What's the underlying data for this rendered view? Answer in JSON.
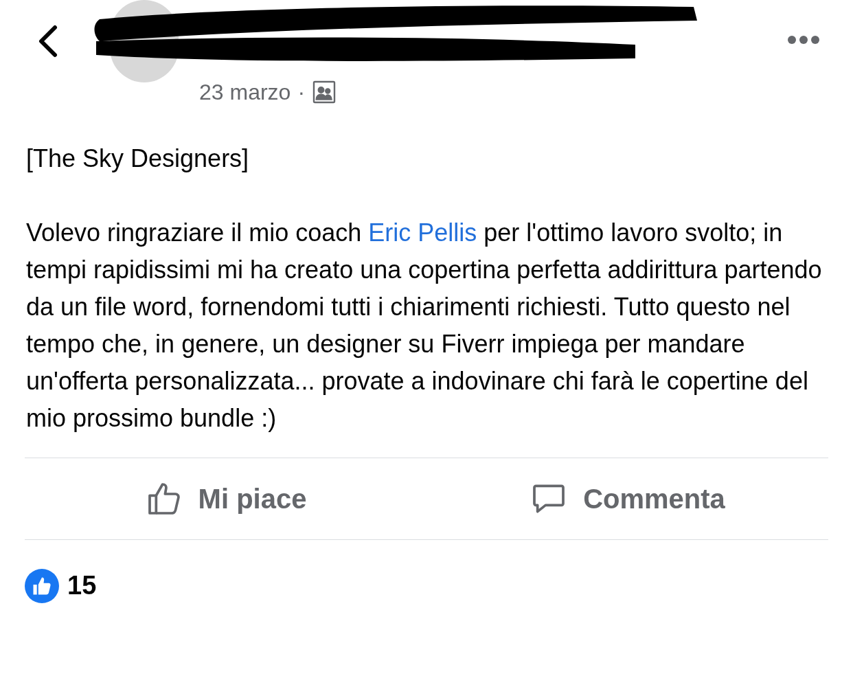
{
  "header": {
    "date": "23 marzo",
    "separator": "·"
  },
  "post": {
    "heading": "[The Sky Designers]",
    "text_before": "Volevo ringraziare il mio coach ",
    "mention": "Eric Pellis",
    "text_after": " per l'ottimo lavoro svolto; in tempi rapidissimi mi ha creato una copertina perfetta addirittura partendo da un file word, fornendomi tutti i chiarimenti richiesti. Tutto questo nel tempo che, in genere, un designer su Fiverr impiega per mandare un'offerta personalizzata... provate a indovinare chi farà le copertine del mio prossimo bundle :)"
  },
  "actions": [
    {
      "kind": "like",
      "label": "Mi piace"
    },
    {
      "kind": "comment",
      "label": "Commenta"
    }
  ],
  "reactions": {
    "count": "15"
  }
}
